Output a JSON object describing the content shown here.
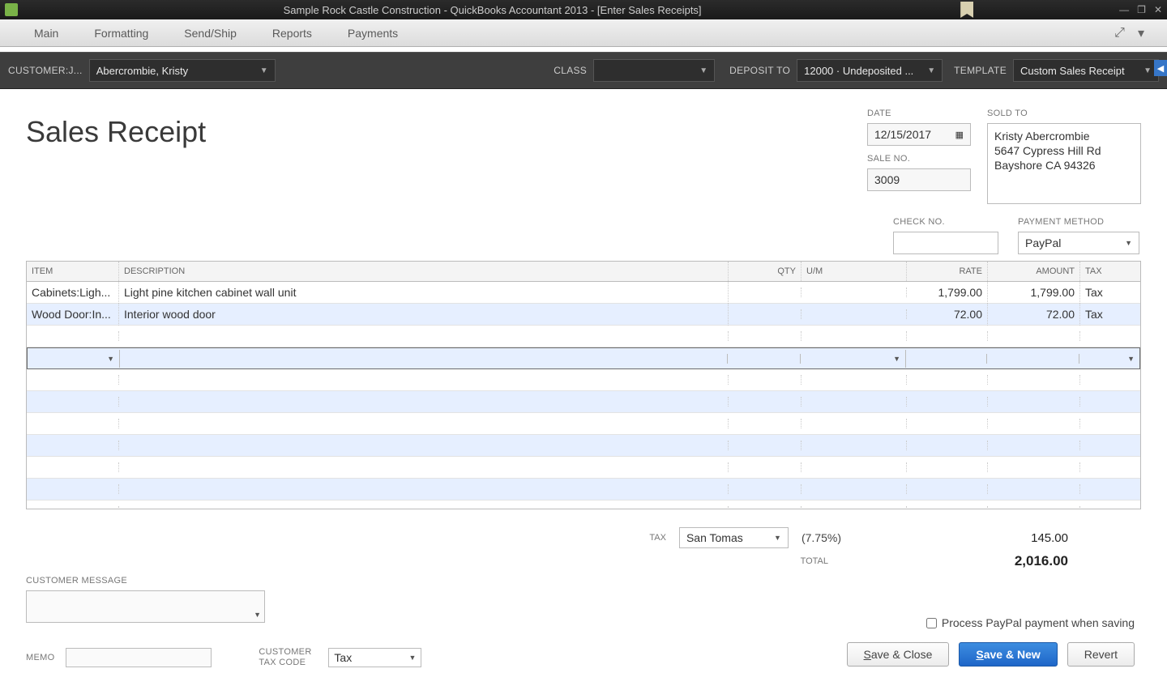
{
  "window": {
    "title": "Sample Rock Castle Construction  - QuickBooks Accountant 2013 - [Enter Sales Receipts]"
  },
  "ribbon": {
    "tabs": [
      "Main",
      "Formatting",
      "Send/Ship",
      "Reports",
      "Payments"
    ]
  },
  "toolbar": {
    "customer_label": "CUSTOMER:J...",
    "customer_value": "Abercrombie, Kristy",
    "class_label": "CLASS",
    "class_value": "",
    "deposit_label": "DEPOSIT TO",
    "deposit_value": "12000 · Undeposited ...",
    "template_label": "TEMPLATE",
    "template_value": "Custom Sales Receipt"
  },
  "header": {
    "title": "Sales Receipt",
    "date_label": "DATE",
    "date_value": "12/15/2017",
    "saleno_label": "SALE NO.",
    "saleno_value": "3009",
    "soldto_label": "SOLD TO",
    "soldto_value": "Kristy Abercrombie\n5647 Cypress Hill Rd\nBayshore CA 94326",
    "checkno_label": "CHECK NO.",
    "checkno_value": "",
    "payment_label": "PAYMENT METHOD",
    "payment_value": "PayPal"
  },
  "grid": {
    "columns": {
      "item": "ITEM",
      "desc": "DESCRIPTION",
      "qty": "QTY",
      "um": "U/M",
      "rate": "RATE",
      "amount": "AMOUNT",
      "tax": "TAX"
    },
    "rows": [
      {
        "item": "Cabinets:Ligh...",
        "desc": "Light pine kitchen cabinet wall unit",
        "qty": "",
        "um": "",
        "rate": "1,799.00",
        "amount": "1,799.00",
        "tax": "Tax"
      },
      {
        "item": "Wood Door:In...",
        "desc": "Interior wood door",
        "qty": "",
        "um": "",
        "rate": "72.00",
        "amount": "72.00",
        "tax": "Tax"
      }
    ]
  },
  "totals": {
    "tax_lbl": "TAX",
    "tax_item": "San Tomas",
    "tax_pct": "(7.75%)",
    "tax_amt": "145.00",
    "total_lbl": "TOTAL",
    "total_amt": "2,016.00"
  },
  "bottom": {
    "cust_msg_lbl": "CUSTOMER MESSAGE",
    "memo_lbl": "MEMO",
    "tax_code_lbl": "CUSTOMER TAX CODE",
    "tax_code_val": "Tax",
    "process_chk": "Process PayPal payment when saving",
    "save_close": "Save & Close",
    "save_new": "Save & New",
    "revert": "Revert"
  }
}
